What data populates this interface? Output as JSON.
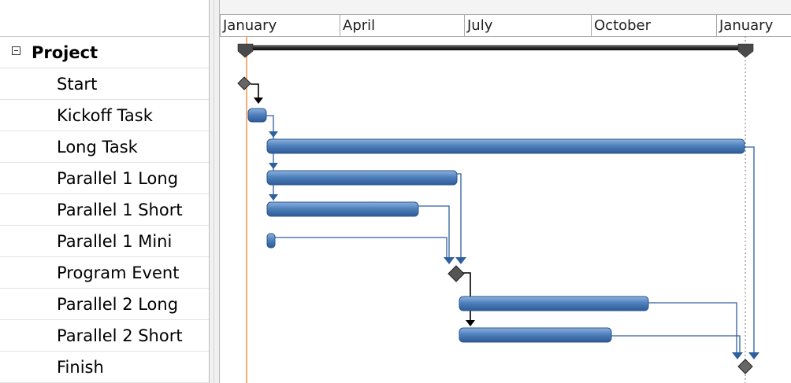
{
  "timescale": {
    "periods": [
      "January",
      "April",
      "July",
      "October",
      "January"
    ]
  },
  "tasks": [
    {
      "name": "Project",
      "type": "summary"
    },
    {
      "name": "Start",
      "type": "milestone"
    },
    {
      "name": "Kickoff Task",
      "type": "task"
    },
    {
      "name": "Long Task",
      "type": "task"
    },
    {
      "name": "Parallel 1 Long",
      "type": "task"
    },
    {
      "name": "Parallel 1 Short",
      "type": "task"
    },
    {
      "name": "Parallel 1 Mini",
      "type": "task"
    },
    {
      "name": "Program Event",
      "type": "milestone"
    },
    {
      "name": "Parallel 2 Long",
      "type": "task"
    },
    {
      "name": "Parallel 2 Short",
      "type": "task"
    },
    {
      "name": "Finish",
      "type": "milestone"
    }
  ],
  "colors": {
    "task_bar": "#4f81bd",
    "task_bar_dark": "#2e5a95",
    "summary_bar": "#3a3a3a",
    "milestone": "#555555",
    "link_blue": "#2f5f9e",
    "link_black": "#000000",
    "today_line": "#f79646"
  }
}
